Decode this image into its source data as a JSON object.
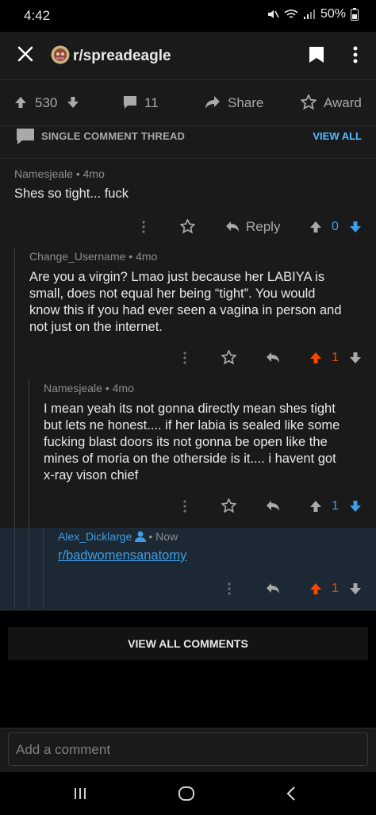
{
  "status": {
    "time": "4:42",
    "battery": "50%"
  },
  "header": {
    "subreddit": "r/spreadeagle"
  },
  "actions": {
    "score": "530",
    "comments": "11",
    "share": "Share",
    "award": "Award"
  },
  "thread": {
    "label": "SINGLE COMMENT THREAD",
    "view_all": "VIEW ALL"
  },
  "comments": [
    {
      "author": "Namesjeale",
      "age": "4mo",
      "body": "Shes so tight... fuck",
      "reply": "Reply",
      "votes": "0"
    },
    {
      "author": "Change_Username",
      "age": "4mo",
      "body": [
        "Are you a virgin? Lmao just because her LABIYA is",
        "small, does not equal her being “tight”. You would",
        "know this if you had ever seen a vagina in person and",
        "not just on the internet."
      ],
      "votes": "1"
    },
    {
      "author": "Namesjeale",
      "age": "4mo",
      "body": [
        "I mean yeah its not gonna directly mean shes tight",
        "but lets ne honest.... if her labia is sealed like some",
        "fucking blast doors its not gonna be open like the",
        "mines of moria on the otherside is it.... i havent got",
        "x-ray vison chief"
      ],
      "votes": "1"
    },
    {
      "author": "Alex_Dicklarge",
      "age": "Now",
      "link": "r/badwomensanatomy",
      "votes": "1"
    }
  ],
  "footer": {
    "view_all_comments": "VIEW ALL COMMENTS",
    "add_comment_placeholder": "Add a comment"
  },
  "colors": {
    "upvote": "#ff4500",
    "downvote_blue": "#3c9ee6",
    "accent": "#4fbcff"
  }
}
